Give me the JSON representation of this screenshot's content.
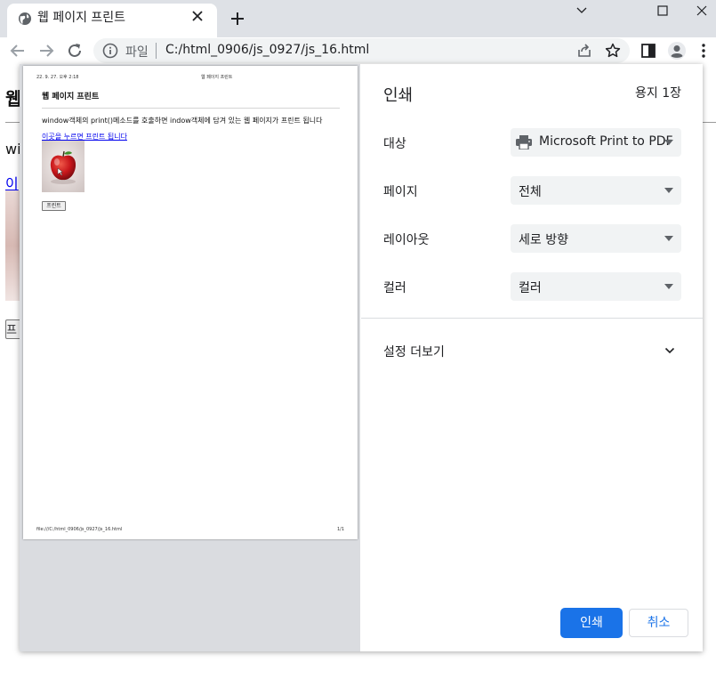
{
  "browser": {
    "tab_title": "웹 페이지 프린트",
    "address_scheme": "파일",
    "address_url": "C:/html_0906/js_0927/js_16.html"
  },
  "page": {
    "heading": "웹",
    "text_start": "wi",
    "link_start": "이",
    "button_start": "프"
  },
  "preview": {
    "header_date": "22. 9. 27. 오후 2:18",
    "header_title": "웹 페이지 프린트",
    "title": "웹 페이지 프린트",
    "body_text": "window객체의 print()메소드를 호출하면 indow객체에 담겨 있는 웹 페이지가 프린트 됩니다",
    "link_text": "이곳을 누르면 프린트 됩니다",
    "button_label": "프린트",
    "footer_url": "file:///C:/html_0906/js_0927/js_16.html",
    "footer_page": "1/1"
  },
  "print_dialog": {
    "title": "인쇄",
    "sheet_count": "용지 1장",
    "destination_label": "대상",
    "destination_value": "Microsoft Print to PDF",
    "pages_label": "페이지",
    "pages_value": "전체",
    "layout_label": "레이아웃",
    "layout_value": "세로 방향",
    "color_label": "컬러",
    "color_value": "컬러",
    "more_settings": "설정 더보기",
    "print_button": "인쇄",
    "cancel_button": "취소"
  },
  "colors": {
    "accent": "#1a73e8",
    "tab_strip": "#dee1e6",
    "select_bg": "#f1f3f4",
    "preview_bg": "#dadce0"
  }
}
